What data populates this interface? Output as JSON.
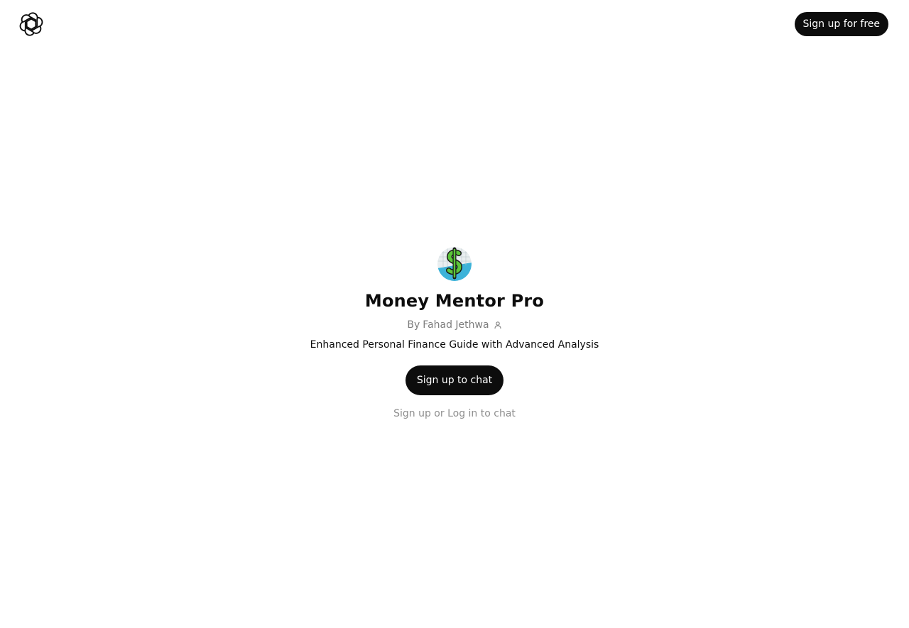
{
  "header": {
    "logo_icon": "openai-logo-icon",
    "signup_free_label": "Sign up for free"
  },
  "gpt": {
    "avatar_icon": "dollar-coin-icon",
    "title": "Money Mentor Pro",
    "by_label": "By",
    "author": "Fahad Jethwa",
    "author_icon": "person-icon",
    "description": "Enhanced Personal Finance Guide with Advanced Analysis"
  },
  "actions": {
    "signup_chat_label": "Sign up to chat",
    "signup_link": "Sign up",
    "or_text": "or",
    "login_link": "Log in",
    "to_chat_text": "to chat"
  },
  "colors": {
    "primary_button": "#0d0d0d",
    "muted_text": "#8e8e8e",
    "avatar_bg": "#3db3d9",
    "dollar_green": "#5cc63a"
  }
}
